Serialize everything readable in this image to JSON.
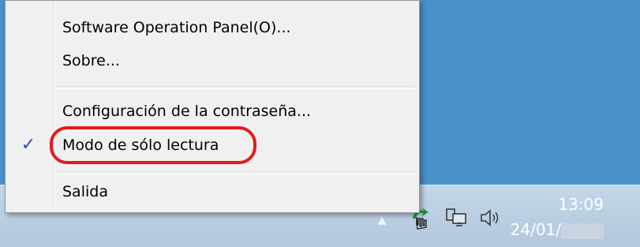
{
  "menu": {
    "items": [
      {
        "label": "Software Operation Panel(O)...",
        "checked": false
      },
      {
        "label": "Sobre...",
        "checked": false
      },
      {
        "label": "Configuración de la contraseña...",
        "checked": false
      },
      {
        "label": "Modo de sólo lectura",
        "checked": true
      },
      {
        "label": "Salida",
        "checked": false
      }
    ],
    "check_glyph": "✓"
  },
  "taskbar": {
    "clock": {
      "time": "13:09",
      "date": "24/01/"
    },
    "tray_icons": [
      "show-hidden-icons-arrow-icon",
      "scanner-app-icon",
      "network-icon",
      "volume-icon"
    ]
  },
  "colors": {
    "highlight_ring": "#e21b1b",
    "desktop": "#4a90c9",
    "check": "#2a4ea8"
  }
}
